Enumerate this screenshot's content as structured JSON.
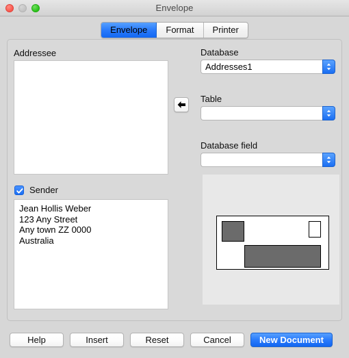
{
  "window": {
    "title": "Envelope"
  },
  "tabs": [
    {
      "label": "Envelope",
      "active": true
    },
    {
      "label": "Format",
      "active": false
    },
    {
      "label": "Printer",
      "active": false
    }
  ],
  "addressee": {
    "label": "Addressee",
    "value": "",
    "placeholder": ""
  },
  "sender": {
    "label": "Sender",
    "checked": true,
    "value": "Jean Hollis Weber\n123 Any Street\nAny town ZZ 0000\nAustralia"
  },
  "transfer": {
    "icon": "arrow-left-icon"
  },
  "database": {
    "label": "Database",
    "value": "Addresses1"
  },
  "table": {
    "label": "Table",
    "value": ""
  },
  "database_field": {
    "label": "Database field",
    "value": ""
  },
  "preview": {
    "name": "envelope-preview"
  },
  "footer": {
    "help": "Help",
    "insert": "Insert",
    "reset": "Reset",
    "cancel": "Cancel",
    "new_document": "New Document"
  },
  "colors": {
    "accent_blue": "#1a6ef2",
    "window_bg": "#d7d7d7",
    "panel_bg": "#d9d9d9",
    "preview_bg": "#e8e8e8",
    "block_gray": "#6b6b6b"
  }
}
